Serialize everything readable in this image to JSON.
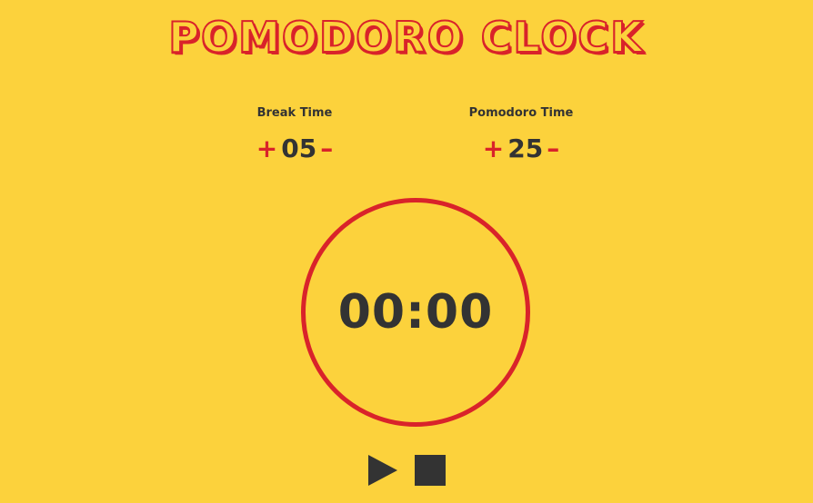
{
  "app": {
    "title": "POMODORO CLOCK"
  },
  "break_setting": {
    "label": "Break Time",
    "increment_symbol": "+",
    "value": "05",
    "decrement_symbol": "–"
  },
  "pomodoro_setting": {
    "label": "Pomodoro Time",
    "increment_symbol": "+",
    "value": "25",
    "decrement_symbol": "–"
  },
  "timer": {
    "display": "00:00"
  },
  "controls": {
    "play_icon": "play-icon",
    "stop_icon": "stop-icon"
  },
  "colors": {
    "background": "#fcd23c",
    "accent": "#d9232a",
    "text": "#333333"
  }
}
